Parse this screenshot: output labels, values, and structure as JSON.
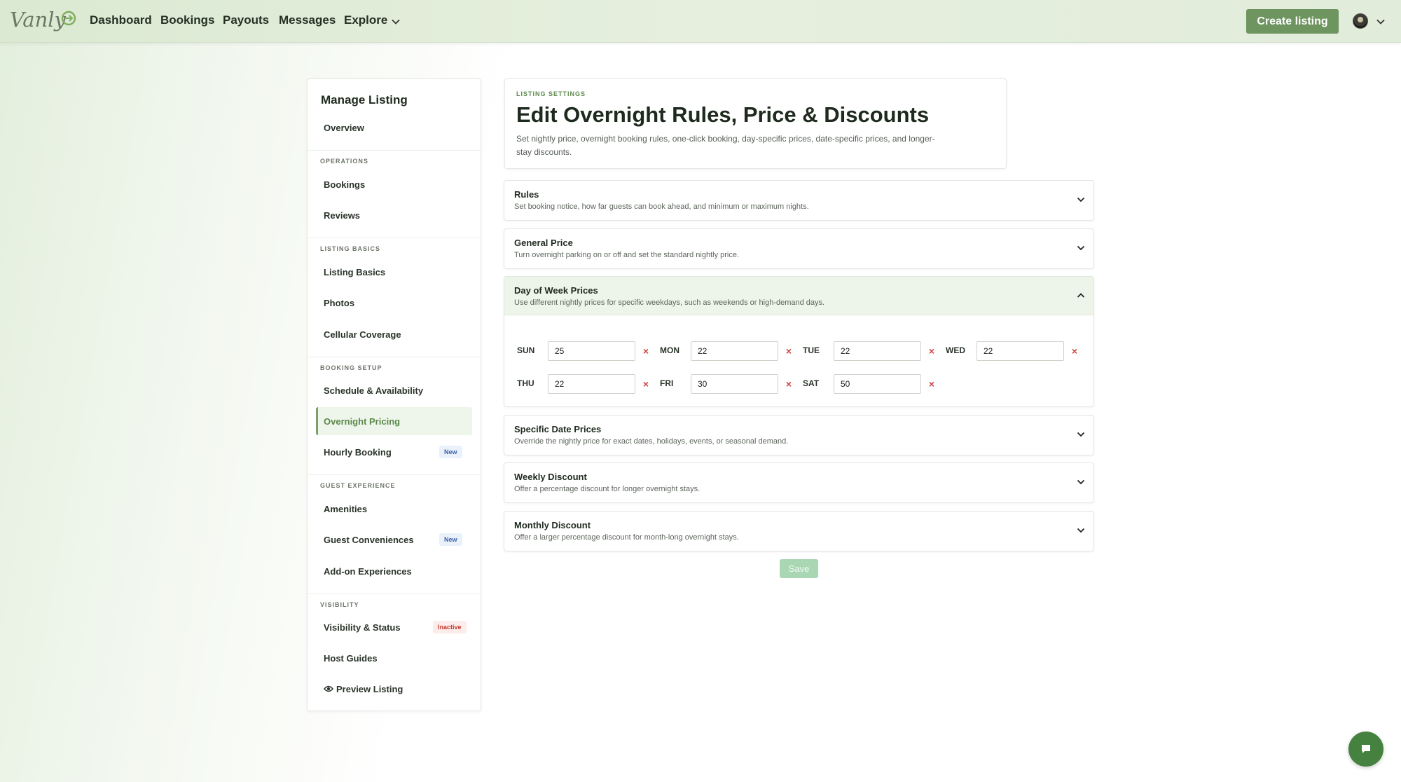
{
  "nav": {
    "logo_text": "Vanly",
    "links": [
      "Dashboard",
      "Bookings",
      "Payouts",
      "Messages",
      "Explore"
    ],
    "create_label": "Create listing"
  },
  "sidebar": {
    "title": "Manage Listing",
    "sections": {
      "operations": "OPERATIONS",
      "listing_basics": "LISTING BASICS",
      "booking_setup": "BOOKING SETUP",
      "guest_experience": "GUEST EXPERIENCE",
      "visibility": "VISIBILITY"
    },
    "items": {
      "overview": "Overview",
      "bookings": "Bookings",
      "reviews": "Reviews",
      "listing_basics": "Listing Basics",
      "photos": "Photos",
      "cellular": "Cellular Coverage",
      "schedule": "Schedule & Availability",
      "overnight": "Overnight Pricing",
      "hourly": "Hourly Booking",
      "amenities": "Amenities",
      "conveniences": "Guest Conveniences",
      "addons": "Add-on Experiences",
      "visibility_status": "Visibility & Status",
      "host_guides": "Host Guides",
      "preview": "Preview Listing"
    },
    "badges": {
      "new": "New",
      "inactive": "Inactive"
    },
    "active_item": "Overnight Pricing"
  },
  "header": {
    "eyebrow": "LISTING SETTINGS",
    "title": "Edit Overnight Rules, Price & Discounts",
    "description": "Set nightly price, overnight booking rules, one-click booking, day-specific prices, date-specific prices, and longer-stay discounts."
  },
  "sections": {
    "rules": {
      "title": "Rules",
      "sub": "Set booking notice, how far guests can book ahead, and minimum or maximum nights."
    },
    "general": {
      "title": "General Price",
      "sub": "Turn overnight parking on or off and set the standard nightly price."
    },
    "dow": {
      "title": "Day of Week Prices",
      "sub": "Use different nightly prices for specific weekdays, such as weekends or high-demand days."
    },
    "specific": {
      "title": "Specific Date Prices",
      "sub": "Override the nightly price for exact dates, holidays, events, or seasonal demand."
    },
    "weekly": {
      "title": "Weekly Discount",
      "sub": "Offer a percentage discount for longer overnight stays."
    },
    "monthly": {
      "title": "Monthly Discount",
      "sub": "Offer a larger percentage discount for month-long overnight stays."
    }
  },
  "days": {
    "sun": {
      "label": "SUN",
      "value": "25"
    },
    "mon": {
      "label": "MON",
      "value": "22"
    },
    "tue": {
      "label": "TUE",
      "value": "22"
    },
    "wed": {
      "label": "WED",
      "value": "22"
    },
    "thu": {
      "label": "THU",
      "value": "22"
    },
    "fri": {
      "label": "FRI",
      "value": "30"
    },
    "sat": {
      "label": "SAT",
      "value": "50"
    }
  },
  "remove_glyph": "×",
  "save_label": "Save",
  "colors": {
    "brand": "#6e9460",
    "accent_text": "#5c8a4d",
    "remove": "#d04040",
    "save_disabled": "#a9d6b3"
  },
  "icons": [
    "vanly-logo-icon",
    "chevron-down-icon",
    "chevron-up-icon",
    "close-icon",
    "eye-icon",
    "chat-icon",
    "avatar"
  ]
}
